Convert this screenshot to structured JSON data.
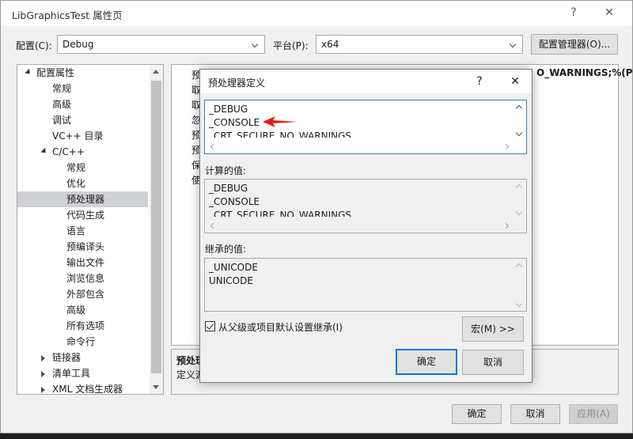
{
  "window": {
    "title": "LibGraphicsTest 属性页",
    "help_glyph": "?",
    "close_glyph": "✕"
  },
  "config": {
    "config_label": "配置(C):",
    "config_value": "Debug",
    "platform_label": "平台(P):",
    "platform_value": "x64",
    "manager_button": "配置管理器(O)..."
  },
  "tree": {
    "items": [
      {
        "label": "配置属性"
      },
      {
        "label": "常规"
      },
      {
        "label": "高级"
      },
      {
        "label": "调试"
      },
      {
        "label": "VC++ 目录"
      },
      {
        "label": "C/C++"
      },
      {
        "label": "常规"
      },
      {
        "label": "优化"
      },
      {
        "label": "预处理器"
      },
      {
        "label": "代码生成"
      },
      {
        "label": "语言"
      },
      {
        "label": "预编译头"
      },
      {
        "label": "输出文件"
      },
      {
        "label": "浏览信息"
      },
      {
        "label": "外部包含"
      },
      {
        "label": "高级"
      },
      {
        "label": "所有选项"
      },
      {
        "label": "命令行"
      },
      {
        "label": "链接器"
      },
      {
        "label": "清单工具"
      },
      {
        "label": "XML 文档生成器"
      }
    ]
  },
  "grid": {
    "row_chars": [
      "预",
      "取",
      "取",
      "忽",
      "预",
      "预",
      "保",
      "使"
    ],
    "value_fragment": "O_WARNINGS;%(P"
  },
  "description": {
    "title": "预处理",
    "text": "定义源"
  },
  "bottom_buttons": {
    "ok": "确定",
    "cancel": "取消",
    "apply": "应用(A)"
  },
  "dialog": {
    "title": "预处理器定义",
    "help_glyph": "?",
    "close_glyph": "✕",
    "editable_lines": [
      "_DEBUG",
      "_CONSOLE",
      "_CRT_SECURE_NO_WARNINGS"
    ],
    "computed_label": "计算的值:",
    "computed_lines": [
      "_DEBUG",
      "_CONSOLE",
      "_CRT_SECURE_NO_WARNINGS"
    ],
    "inherited_label": "继承的值:",
    "inherited_lines": [
      "_UNICODE",
      "UNICODE"
    ],
    "inherit_checkbox": "从父级或项目默认设置继承(I)",
    "inherit_checked": true,
    "macro_button": "宏(M) >>",
    "ok": "确定",
    "cancel": "取消"
  },
  "annotation_color": "#e02020",
  "accent_color": "#0078d7"
}
